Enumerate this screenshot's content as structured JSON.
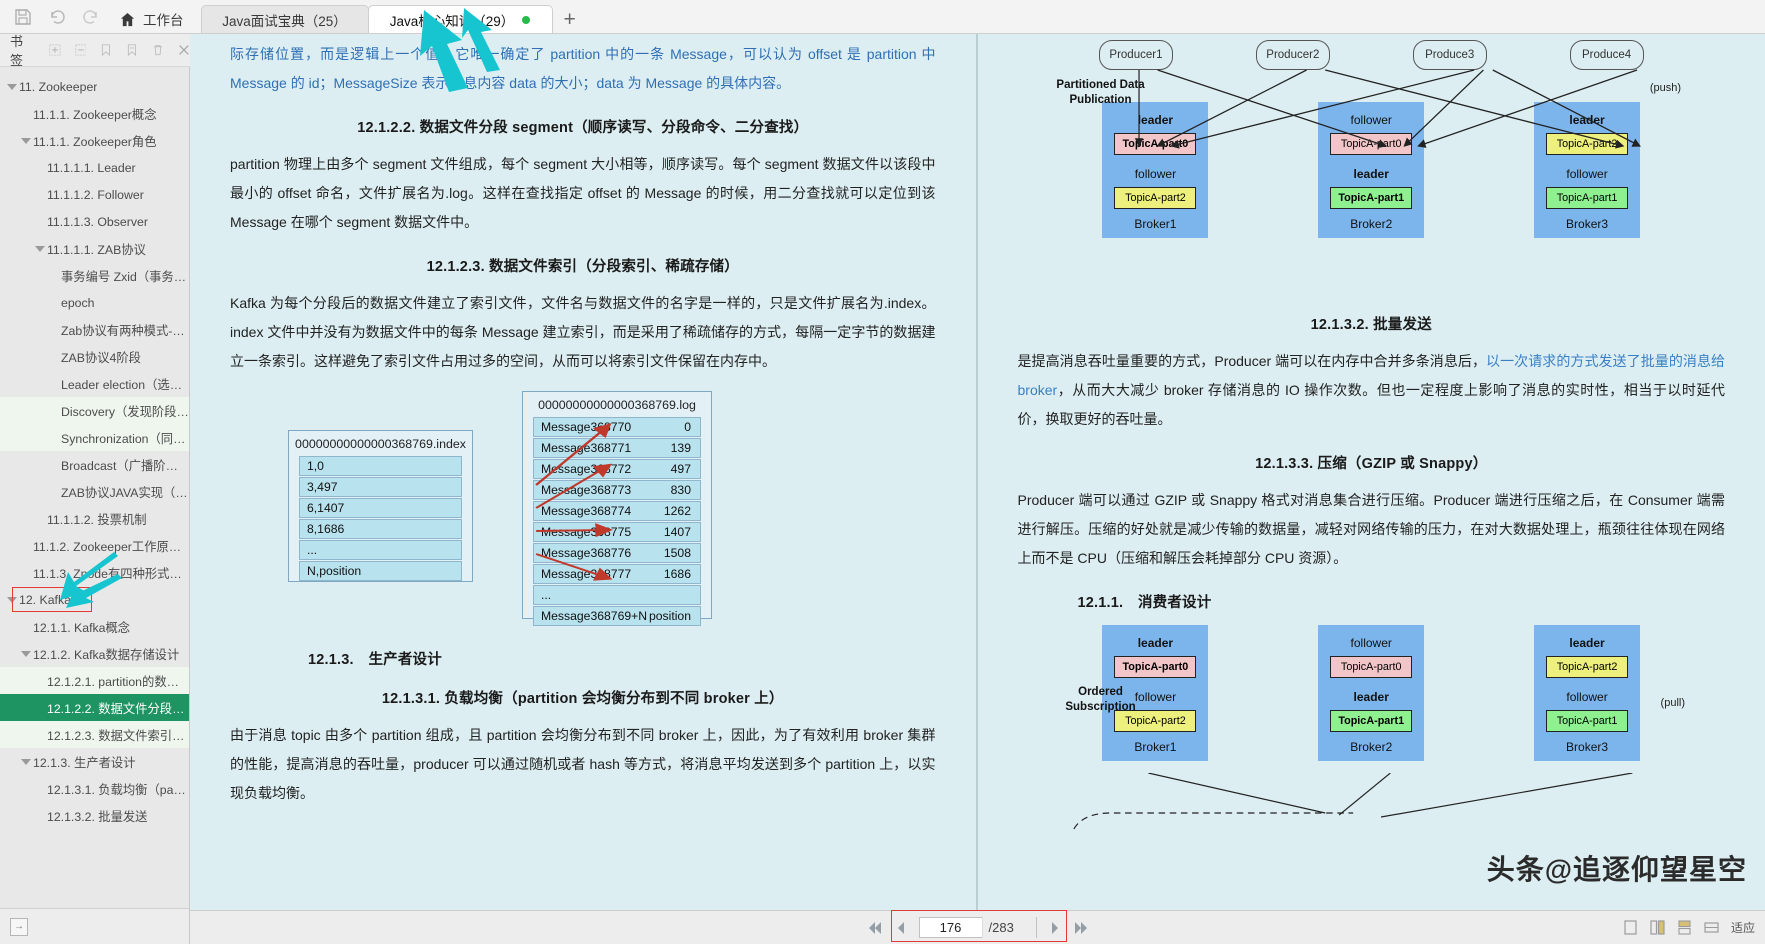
{
  "window": {
    "toolbar_icons": [
      "save-icon",
      "undo-icon",
      "redo-icon"
    ],
    "home_tab": "工作台",
    "new_tab_label": "+"
  },
  "tabs": [
    {
      "label": "Java面试宝典（25）",
      "active": false
    },
    {
      "label": "Java核心知识（29）",
      "active": true
    }
  ],
  "bookmark_bar": {
    "label": "书签",
    "icons": [
      "add-bookmark-icon",
      "remove-bookmark-icon",
      "bookmark-prev-icon",
      "bookmark-next-icon",
      "delete-icon",
      "close-icon"
    ]
  },
  "sidebar": {
    "items": [
      {
        "label": "11. Zookeeper",
        "indent": 0,
        "arrow": true,
        "state": "normal"
      },
      {
        "label": "11.1.1. Zookeeper概念",
        "indent": 1,
        "arrow": false,
        "state": "normal"
      },
      {
        "label": "11.1.1. Zookeeper角色",
        "indent": 1,
        "arrow": true,
        "state": "normal"
      },
      {
        "label": "11.1.1.1. Leader",
        "indent": 2,
        "arrow": false,
        "state": "normal"
      },
      {
        "label": "11.1.1.2. Follower",
        "indent": 2,
        "arrow": false,
        "state": "normal"
      },
      {
        "label": "11.1.1.3. Observer",
        "indent": 2,
        "arrow": false,
        "state": "normal"
      },
      {
        "label": "11.1.1.1. ZAB协议",
        "indent": 2,
        "arrow": true,
        "state": "normal"
      },
      {
        "label": "事务编号 Zxid（事务请求...",
        "indent": 3,
        "arrow": false,
        "state": "normal"
      },
      {
        "label": "epoch",
        "indent": 3,
        "arrow": false,
        "state": "normal"
      },
      {
        "label": "Zab协议有两种模式-恢复...",
        "indent": 3,
        "arrow": false,
        "state": "normal"
      },
      {
        "label": "ZAB协议4阶段",
        "indent": 3,
        "arrow": false,
        "state": "normal"
      },
      {
        "label": "Leader election（选举阶...",
        "indent": 3,
        "arrow": false,
        "state": "normal"
      },
      {
        "label": "Discovery（发现阶段-接...",
        "indent": 3,
        "arrow": false,
        "state": "hl"
      },
      {
        "label": "Synchronization（同步阶...",
        "indent": 3,
        "arrow": false,
        "state": "hl"
      },
      {
        "label": "Broadcast（广播阶段-lea...",
        "indent": 3,
        "arrow": false,
        "state": "normal"
      },
      {
        "label": "ZAB协议JAVA实现（FLE-...",
        "indent": 3,
        "arrow": false,
        "state": "normal"
      },
      {
        "label": "11.1.1.2. 投票机制",
        "indent": 2,
        "arrow": false,
        "state": "normal"
      },
      {
        "label": "11.1.2. Zookeeper工作原理...",
        "indent": 1,
        "arrow": false,
        "state": "normal"
      },
      {
        "label": "11.1.3.  Znode有四种形式的...",
        "indent": 1,
        "arrow": false,
        "state": "normal"
      },
      {
        "label": "12. Kafka",
        "indent": 0,
        "arrow": true,
        "state": "boxed"
      },
      {
        "label": "12.1.1. Kafka概念",
        "indent": 1,
        "arrow": false,
        "state": "normal"
      },
      {
        "label": "12.1.2. Kafka数据存储设计",
        "indent": 1,
        "arrow": true,
        "state": "normal"
      },
      {
        "label": "12.1.2.1. partition的数据文...",
        "indent": 2,
        "arrow": false,
        "state": "hl"
      },
      {
        "label": "12.1.2.2. 数据文件分段seg...",
        "indent": 2,
        "arrow": false,
        "state": "sel"
      },
      {
        "label": "12.1.2.3. 数据文件索引（分...",
        "indent": 2,
        "arrow": false,
        "state": "hl"
      },
      {
        "label": "12.1.3. 生产者设计",
        "indent": 1,
        "arrow": true,
        "state": "normal"
      },
      {
        "label": "12.1.3.1. 负载均衡（partiti...",
        "indent": 2,
        "arrow": false,
        "state": "normal"
      },
      {
        "label": "12.1.3.2. 批量发送",
        "indent": 2,
        "arrow": false,
        "state": "normal"
      }
    ],
    "bottom_button": "expand-sidebar-icon"
  },
  "page_left": {
    "top_paragraph": "际存储位置，而是逻辑上一个值，它唯一确定了 partition 中的一条 Message，可以认为 offset 是 partition 中 Message 的 id；MessageSize 表示消息内容 data 的大小；data 为 Message 的具体内容。",
    "heading_1": "12.1.2.2.  数据文件分段 segment（顺序读写、分段命令、二分查找）",
    "paragraph_1": "partition 物理上由多个 segment 文件组成，每个 segment 大小相等，顺序读写。每个 segment 数据文件以该段中最小的 offset 命名，文件扩展名为.log。这样在查找指定 offset 的 Message 的时候，用二分查找就可以定位到该 Message 在哪个 segment 数据文件中。",
    "heading_2": "12.1.2.3.  数据文件索引（分段索引、稀疏存储）",
    "paragraph_2": "Kafka 为每个分段后的数据文件建立了索引文件，文件名与数据文件的名字是一样的，只是文件扩展名为.index。index 文件中并没有为数据文件中的每条 Message 建立索引，而是采用了稀疏储存的方式，每隔一定字节的数据建立一条索引。这样避免了索引文件占用过多的空间，从而可以将索引文件保留在内存中。",
    "heading_3": "12.1.3.　生产者设计",
    "heading_4": "12.1.3.1.  负载均衡（partition 会均衡分布到不同 broker 上）",
    "paragraph_3": "由于消息 topic 由多个 partition 组成，且 partition 会均衡分布到不同 broker 上，因此，为了有效利用 broker 集群的性能，提高消息的吞吐量，producer 可以通过随机或者 hash 等方式，将消息平均发送到多个 partition 上，以实现负载均衡。"
  },
  "index_diagram": {
    "index_file_title": "00000000000000368769.index",
    "index_rows": [
      "1,0",
      "3,497",
      "6,1407",
      "8,1686",
      "...",
      "N,position"
    ],
    "log_file_title": "00000000000000368769.log",
    "log_rows": [
      {
        "name": "Message368770",
        "offset": "0"
      },
      {
        "name": "Message368771",
        "offset": "139"
      },
      {
        "name": "Message368772",
        "offset": "497"
      },
      {
        "name": "Message368773",
        "offset": "830"
      },
      {
        "name": "Message368774",
        "offset": "1262"
      },
      {
        "name": "Message368775",
        "offset": "1407"
      },
      {
        "name": "Message368776",
        "offset": "1508"
      },
      {
        "name": "Message368777",
        "offset": "1686"
      },
      {
        "name": "...",
        "offset": ""
      },
      {
        "name": "Message368769+N",
        "offset": "position"
      }
    ]
  },
  "page_right": {
    "heading_1": "12.1.3.2.  批量发送",
    "paragraph_1_a": "是提高消息吞吐量重要的方式，Producer 端可以在内存中合并多条消息后，",
    "paragraph_1_link": "以一次请求的方式发送了批量的消息给 broker",
    "paragraph_1_b": "，从而大大减少 broker 存储消息的 IO 操作次数。但也一定程度上影响了消息的实时性，相当于以时延代价，换取更好的吞吐量。",
    "heading_2": "12.1.3.3.  压缩（GZIP 或 Snappy）",
    "paragraph_2": "Producer 端可以通过 GZIP 或 Snappy 格式对消息集合进行压缩。Producer 端进行压缩之后，在 Consumer 端需进行解压。压缩的好处就是减少传输的数据量，减轻对网络传输的压力，在对大数据处理上，瓶颈往往体现在网络上而不是 CPU（压缩和解压会耗掉部分 CPU 资源）。",
    "heading_3": "12.1.1.　消费者设计"
  },
  "kafka_diagram_top": {
    "producers": [
      "Producer1",
      "Producer2",
      "Produce3",
      "Produce4"
    ],
    "label": "Partitioned Data\nPublication",
    "label_line1": "Partitioned Data",
    "label_line2": "Publication",
    "mode": "(push)",
    "brokers": [
      {
        "name": "Broker1",
        "top_role": "leader",
        "top_role_bold": true,
        "top_part": "TopicA-part0",
        "top_color": "pink",
        "bottom_role": "follower",
        "bottom_role_bold": false,
        "bottom_part": "TopicA-part2",
        "bottom_color": "yellow"
      },
      {
        "name": "Broker2",
        "top_role": "follower",
        "top_role_bold": false,
        "top_part": "TopicA-part0",
        "top_color": "pink",
        "bottom_role": "leader",
        "bottom_role_bold": true,
        "bottom_part": "TopicA-part1",
        "bottom_color": "green"
      },
      {
        "name": "Broker3",
        "top_role": "leader",
        "top_role_bold": true,
        "top_part": "TopicA-part2",
        "top_color": "yellow",
        "bottom_role": "follower",
        "bottom_role_bold": false,
        "bottom_part": "TopicA-part1",
        "bottom_color": "green"
      }
    ]
  },
  "kafka_diagram_bottom": {
    "label_line1": "Ordered",
    "label_line2": "Subscription",
    "mode": "(pull)",
    "brokers": [
      {
        "name": "Broker1",
        "top_role": "leader",
        "top_role_bold": true,
        "top_part": "TopicA-part0",
        "top_color": "pink",
        "bottom_role": "follower",
        "bottom_role_bold": false,
        "bottom_part": "TopicA-part2",
        "bottom_color": "yellow"
      },
      {
        "name": "Broker2",
        "top_role": "follower",
        "top_role_bold": false,
        "top_part": "TopicA-part0",
        "top_color": "pink",
        "bottom_role": "leader",
        "bottom_role_bold": true,
        "bottom_part": "TopicA-part1",
        "bottom_color": "green"
      },
      {
        "name": "Broker3",
        "top_role": "leader",
        "top_role_bold": true,
        "top_part": "TopicA-part2",
        "top_color": "yellow",
        "bottom_role": "follower",
        "bottom_role_bold": false,
        "bottom_part": "TopicA-part1",
        "bottom_color": "green"
      }
    ]
  },
  "watermark": "头条@追逐仰望星空",
  "statusbar": {
    "current_page": "176",
    "total_pages": "/283",
    "first_icon": "first-page-icon",
    "prev_icon": "prev-page-icon",
    "next_icon": "next-page-icon",
    "last_icon": "last-page-icon",
    "view_icons": [
      "single-page-icon",
      "two-page-icon",
      "continuous-icon",
      "fit-width-icon"
    ],
    "right_label": "适应"
  },
  "colors": {
    "selection_green": "#1e9462",
    "highlight_green": "#eef6ee",
    "page_bg": "#dceef2",
    "red_box": "#e23b34",
    "teal_arrow": "#17c5d1",
    "link_blue": "#2f6fb5",
    "broker_blue": "#7cb5ec"
  }
}
